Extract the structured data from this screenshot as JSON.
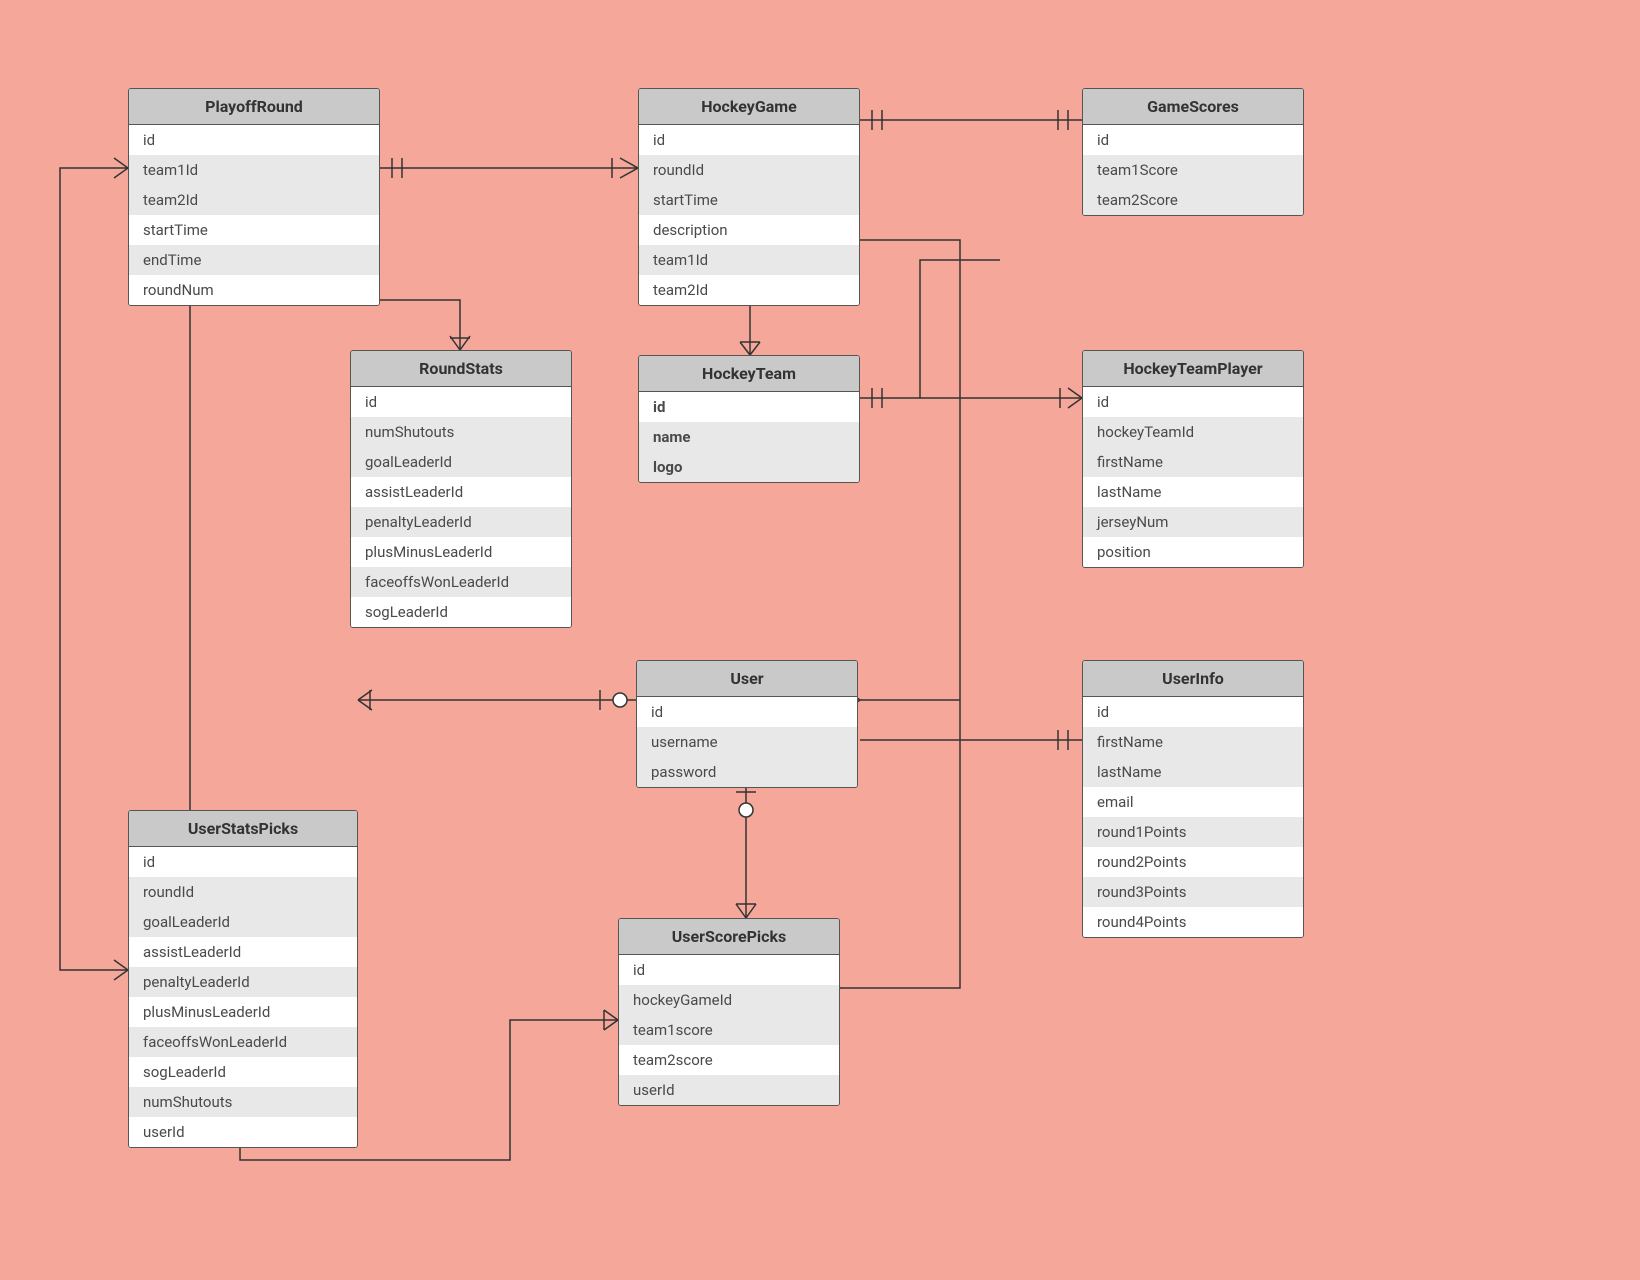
{
  "entities": {
    "playoffRound": {
      "title": "PlayoffRound",
      "fields": [
        "id",
        "team1Id",
        "team2Id",
        "startTime",
        "endTime",
        "roundNum"
      ]
    },
    "hockeyGame": {
      "title": "HockeyGame",
      "fields": [
        "id",
        "roundId",
        "startTime",
        "description",
        "team1Id",
        "team2Id"
      ]
    },
    "gameScores": {
      "title": "GameScores",
      "fields": [
        "id",
        "team1Score",
        "team2Score"
      ]
    },
    "roundStats": {
      "title": "RoundStats",
      "fields": [
        "id",
        "numShutouts",
        "goalLeaderId",
        "assistLeaderId",
        "penaltyLeaderId",
        "plusMinusLeaderId",
        "faceoffsWonLeaderId",
        "sogLeaderId"
      ]
    },
    "hockeyTeam": {
      "title": "HockeyTeam",
      "fields": [
        "id",
        "name",
        "logo"
      ],
      "bold": true
    },
    "hockeyTeamPlayer": {
      "title": "HockeyTeamPlayer",
      "fields": [
        "id",
        "hockeyTeamId",
        "firstName",
        "lastName",
        "jerseyNum",
        "position"
      ]
    },
    "user": {
      "title": "User",
      "fields": [
        "id",
        "username",
        "password"
      ]
    },
    "userInfo": {
      "title": "UserInfo",
      "fields": [
        "id",
        "firstName",
        "lastName",
        "email",
        "round1Points",
        "round2Points",
        "round3Points",
        "round4Points"
      ]
    },
    "userStatsPicks": {
      "title": "UserStatsPicks",
      "fields": [
        "id",
        "roundId",
        "goalLeaderId",
        "assistLeaderId",
        "penaltyLeaderId",
        "plusMinusLeaderId",
        "faceoffsWonLeaderId",
        "sogLeaderId",
        "numShutouts",
        "userId"
      ]
    },
    "userScorePicks": {
      "title": "UserScorePicks",
      "fields": [
        "id",
        "hockeyGameId",
        "team1score",
        "team2score",
        "userId"
      ]
    }
  }
}
